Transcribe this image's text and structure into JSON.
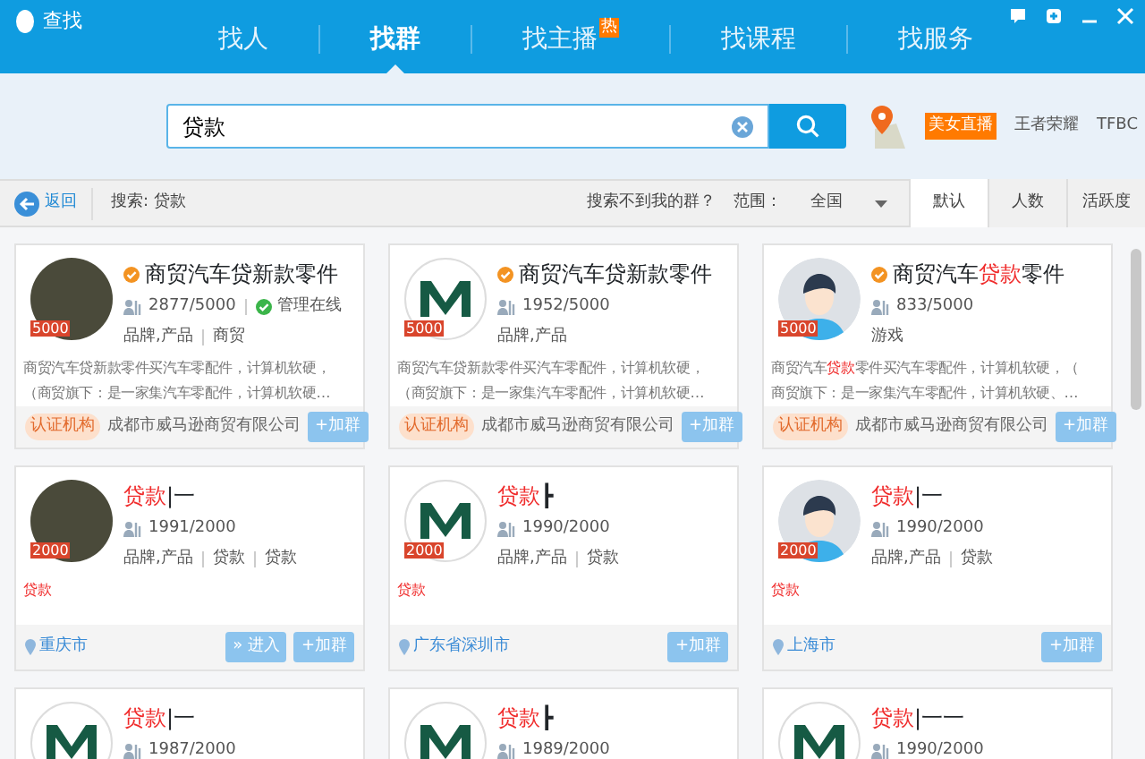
{
  "window": {
    "title": "查找"
  },
  "tabs": [
    {
      "label": "找人",
      "selected": false
    },
    {
      "label": "找群",
      "selected": true
    },
    {
      "label": "找主播",
      "selected": false,
      "badge": "热"
    },
    {
      "label": "找课程",
      "selected": false
    },
    {
      "label": "找服务",
      "selected": false
    }
  ],
  "search": {
    "value": "贷款"
  },
  "hot_keywords": [
    {
      "label": "美女直播",
      "kind": "tag"
    },
    {
      "label": "王者荣耀",
      "kind": "plain"
    },
    {
      "label": "TFBC",
      "kind": "plain"
    }
  ],
  "toolbar": {
    "back": "返回",
    "query": "搜索: 贷款",
    "not_found": "搜索不到我的群？",
    "range_label": "范围：",
    "range_value": "全国",
    "sort": [
      {
        "label": "默认",
        "selected": true
      },
      {
        "label": "人数",
        "selected": false
      },
      {
        "label": "活跃度",
        "selected": false
      }
    ]
  },
  "groups": [
    {
      "kind": "photo",
      "badge": "5000",
      "verified": true,
      "name": [
        {
          "text": "商贸汽车贷新款零件",
          "hit": false
        }
      ],
      "members": "2877/5000",
      "online": "管理在线",
      "tags": [
        "品牌,产品",
        "商贸"
      ],
      "description": [
        [
          {
            "text": "商贸汽车贷新款零件买汽车零配件，计算机软硬，",
            "hit": false
          }
        ],
        [
          {
            "text": "（商贸旗下：是一家集汽车零配件，计算机软硬…",
            "hit": false
          }
        ]
      ],
      "certified": "认证机构",
      "company": "成都市威马逊商贸有限公司",
      "buttons": [
        "+加群"
      ]
    },
    {
      "kind": "logo",
      "badge": "5000",
      "verified": true,
      "name": [
        {
          "text": "商贸汽车贷新款零件",
          "hit": false
        }
      ],
      "members": "1952/5000",
      "tags": [
        "品牌,产品"
      ],
      "description": [
        [
          {
            "text": "商贸汽车贷新款零件买汽车零配件，计算机软硬，",
            "hit": false
          }
        ],
        [
          {
            "text": "（商贸旗下：是一家集汽车零配件，计算机软硬…",
            "hit": false
          }
        ]
      ],
      "certified": "认证机构",
      "company": "成都市威马逊商贸有限公司",
      "buttons": [
        "+加群"
      ]
    },
    {
      "kind": "person",
      "badge": "5000",
      "verified": true,
      "name": [
        {
          "text": "商贸汽车",
          "hit": false
        },
        {
          "text": "贷款",
          "hit": true
        },
        {
          "text": "零件",
          "hit": false
        }
      ],
      "members": "833/5000",
      "tags": [
        "游戏"
      ],
      "description": [
        [
          {
            "text": "商贸汽车",
            "hit": false
          },
          {
            "text": "贷款",
            "hit": true
          },
          {
            "text": "零件买汽车零配件，计算机软硬，（",
            "hit": false
          }
        ],
        [
          {
            "text": "商贸旗下：是一家集汽车零配件，计算机软硬、…",
            "hit": false
          }
        ]
      ],
      "certified": "认证机构",
      "company": "成都市威马逊商贸有限公司",
      "buttons": [
        "+加群"
      ]
    },
    {
      "kind": "photo",
      "badge": "2000",
      "verified": false,
      "name": [
        {
          "text": "贷款",
          "hit": true
        },
        {
          "text": "|一",
          "hit": false
        }
      ],
      "members": "1991/2000",
      "tags": [
        "品牌,产品",
        "贷款",
        "贷款"
      ],
      "description": [
        [
          {
            "text": "贷款",
            "hit": true
          }
        ]
      ],
      "location": "重庆市",
      "buttons": [
        "» 进入",
        "+加群"
      ]
    },
    {
      "kind": "logo",
      "badge": "2000",
      "verified": false,
      "name": [
        {
          "text": "贷款",
          "hit": true
        },
        {
          "text": "┣",
          "hit": false
        }
      ],
      "members": "1990/2000",
      "tags": [
        "品牌,产品",
        "贷款"
      ],
      "description": [
        [
          {
            "text": "贷款",
            "hit": true
          }
        ]
      ],
      "location": "广东省深圳市",
      "buttons": [
        "+加群"
      ]
    },
    {
      "kind": "person",
      "badge": "2000",
      "verified": false,
      "name": [
        {
          "text": "贷款",
          "hit": true
        },
        {
          "text": "|一",
          "hit": false
        }
      ],
      "members": "1990/2000",
      "tags": [
        "品牌,产品",
        "贷款"
      ],
      "description": [
        [
          {
            "text": "贷款",
            "hit": true
          }
        ]
      ],
      "location": "上海市",
      "buttons": [
        "+加群"
      ]
    },
    {
      "kind": "logo",
      "verified": false,
      "name": [
        {
          "text": "贷款",
          "hit": true
        },
        {
          "text": "|一",
          "hit": false
        }
      ],
      "members": "1987/2000"
    },
    {
      "kind": "logo",
      "verified": false,
      "name": [
        {
          "text": "贷款",
          "hit": true
        },
        {
          "text": "┣",
          "hit": false
        }
      ],
      "members": "1989/2000"
    },
    {
      "kind": "logo",
      "verified": false,
      "name": [
        {
          "text": "贷款",
          "hit": true
        },
        {
          "text": "|一一",
          "hit": false
        }
      ],
      "members": "1990/2000"
    }
  ]
}
